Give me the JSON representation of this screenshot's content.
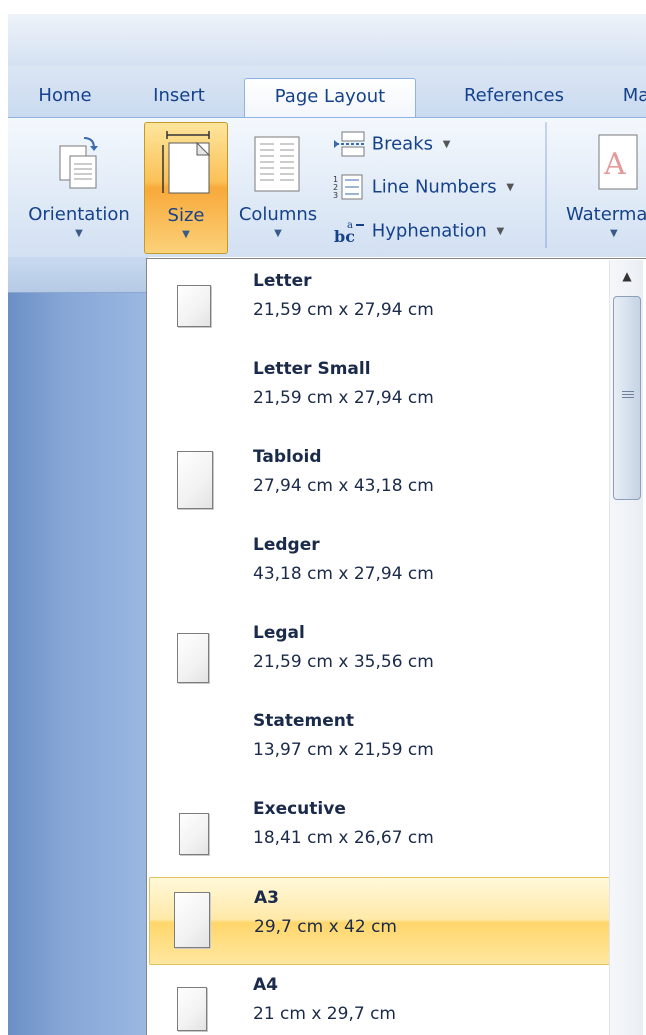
{
  "tabs": [
    {
      "label": "Home",
      "active": false
    },
    {
      "label": "Insert",
      "active": false
    },
    {
      "label": "Page Layout",
      "active": true
    },
    {
      "label": "References",
      "active": false
    },
    {
      "label": "Ma",
      "active": false
    }
  ],
  "ribbon": {
    "orientation_label": "Orientation",
    "size_label": "Size",
    "columns_label": "Columns",
    "breaks_label": "Breaks",
    "line_numbers_label": "Line Numbers",
    "hyphenation_label": "Hyphenation",
    "watermark_label": "Waterma"
  },
  "size_menu": {
    "items": [
      {
        "name": "Letter",
        "dims": "21,59 cm x 27,94 cm",
        "icon": "page-icon"
      },
      {
        "name": "Letter Small",
        "dims": "21,59 cm x 27,94 cm",
        "icon": ""
      },
      {
        "name": "Tabloid",
        "dims": "27,94 cm x 43,18 cm",
        "icon": "page-icon"
      },
      {
        "name": "Ledger",
        "dims": "43,18 cm x 27,94 cm",
        "icon": ""
      },
      {
        "name": "Legal",
        "dims": "21,59 cm x 35,56 cm",
        "icon": "page-icon"
      },
      {
        "name": "Statement",
        "dims": "13,97 cm x 21,59 cm",
        "icon": ""
      },
      {
        "name": "Executive",
        "dims": "18,41 cm x 26,67 cm",
        "icon": "page-icon"
      },
      {
        "name": "A3",
        "dims": "29,7 cm x 42 cm",
        "icon": "page-icon",
        "hovered": true
      },
      {
        "name": "A4",
        "dims": "21 cm x 29,7 cm",
        "icon": "page-icon"
      }
    ]
  },
  "colors": {
    "accent_hover": "#ffd66b",
    "tab_text": "#15428b",
    "ribbon_bg": "#dfe9f5"
  }
}
